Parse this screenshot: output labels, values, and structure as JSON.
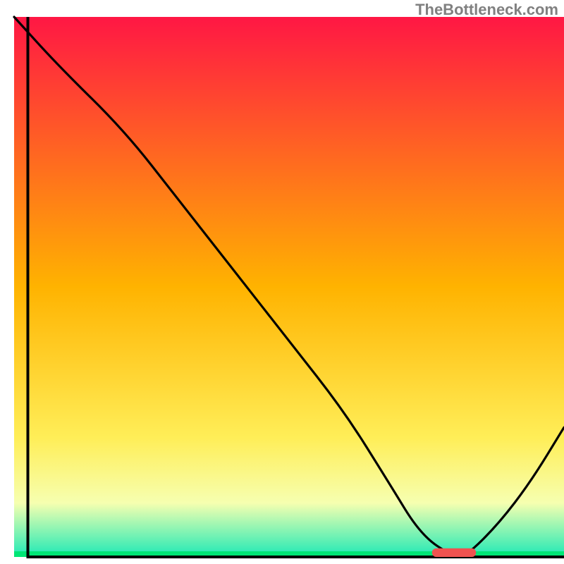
{
  "watermark": "TheBottleneck.com",
  "chart_data": {
    "type": "line",
    "title": "",
    "xlabel": "",
    "ylabel": "",
    "xlim": [
      0,
      100
    ],
    "ylim": [
      0,
      100
    ],
    "grid": false,
    "legend": false,
    "background_gradient": {
      "top": "#ff1744",
      "mid_upper": "#ffb300",
      "mid_lower": "#ffee58",
      "band": "#f6ffb0",
      "bottom": "#1de9b6"
    },
    "series": [
      {
        "name": "bottleneck_curve",
        "color": "#000000",
        "x": [
          0,
          8,
          20,
          30,
          40,
          50,
          60,
          68,
          74,
          80,
          82,
          88,
          94,
          100
        ],
        "y": [
          100,
          91,
          79,
          66,
          53,
          40,
          27,
          14,
          4,
          0,
          0,
          6,
          14,
          24
        ]
      }
    ],
    "marker": {
      "name": "optimal_zone",
      "color": "#ef5350",
      "x_range": [
        76,
        84
      ],
      "y": 0.8,
      "thickness_pct": 1.6
    },
    "frame": {
      "left_x": 2.5,
      "right_x": 100,
      "top_y": 100,
      "bottom_y": 0
    }
  }
}
